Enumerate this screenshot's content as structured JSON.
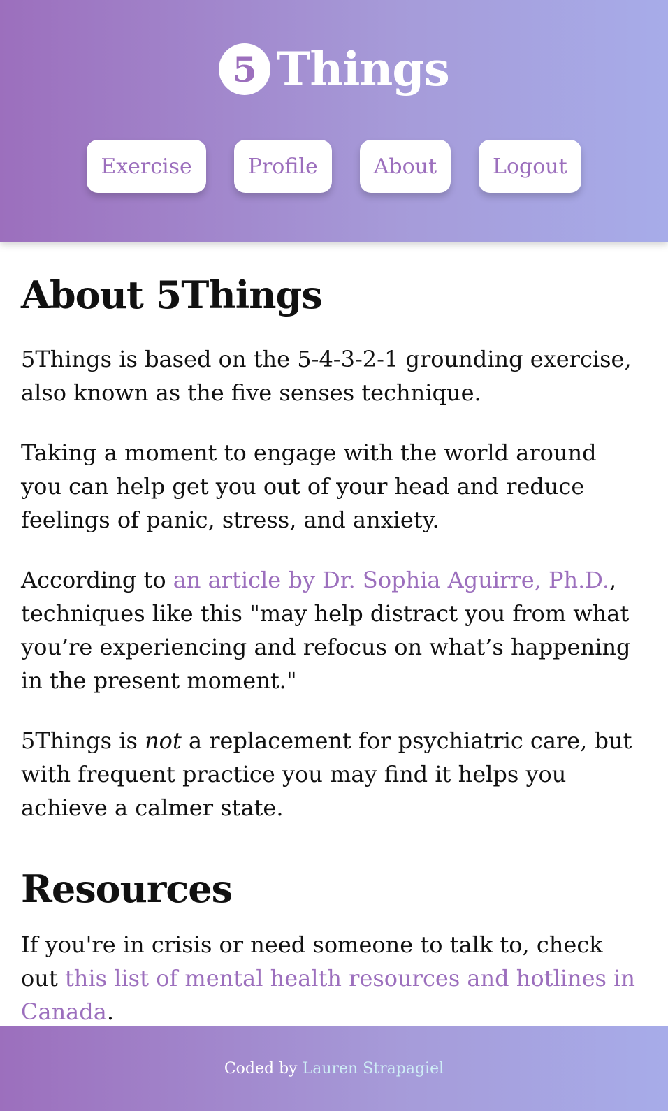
{
  "brand": {
    "badge": "5",
    "name": "Things",
    "primary_color": "#9c6fbd",
    "gradient_end_color": "#a7ace9"
  },
  "nav": {
    "items": [
      {
        "label": "Exercise"
      },
      {
        "label": "Profile"
      },
      {
        "label": "About"
      },
      {
        "label": "Logout"
      }
    ]
  },
  "about": {
    "heading": "About 5Things",
    "p1": "5Things is based on the 5-4-3-2-1 grounding exercise, also known as the five senses technique.",
    "p2": "Taking a moment to engage with the world around you can help get you out of your head and reduce feelings of panic, stress, and anxiety.",
    "p3_before": "According to ",
    "p3_link": "an article by Dr. Sophia Aguirre, Ph.D.",
    "p3_after": ", techniques like this \"may help distract you from what you’re experiencing and refocus on what’s happening in the present moment.\"",
    "p4_before": "5Things is ",
    "p4_emph": "not",
    "p4_after": " a replacement for psychiatric care, but with frequent practice you may find it helps you achieve a calmer state."
  },
  "resources": {
    "heading": "Resources",
    "text_before": "If you're in crisis or need someone to talk to, check out ",
    "link": "this list of mental health resources and hotlines in Canada",
    "text_after": "."
  },
  "footer": {
    "prefix": "Coded by",
    "author_link": "Lauren Strapagiel",
    "link_color": "#cfeef6"
  }
}
